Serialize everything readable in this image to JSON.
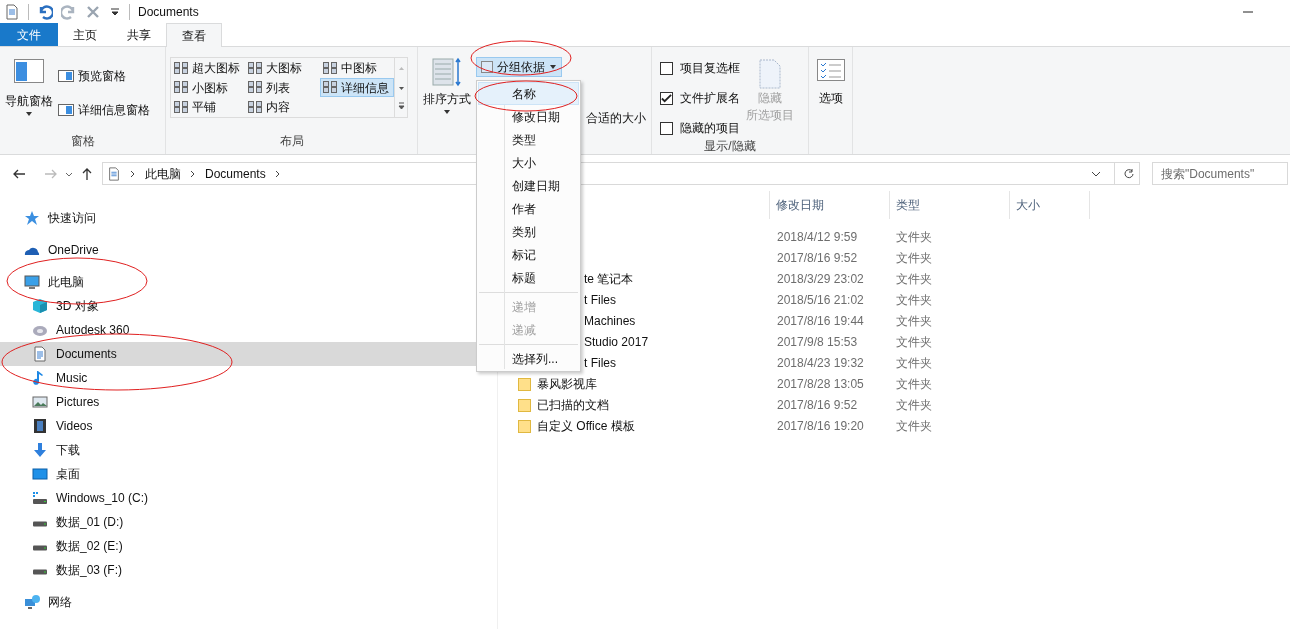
{
  "title_bar": {
    "title": "Documents"
  },
  "ribbon_tabs": [
    {
      "label": "文件",
      "kind": "file",
      "selected": false
    },
    {
      "label": "主页",
      "kind": "tab",
      "selected": false
    },
    {
      "label": "共享",
      "kind": "tab",
      "selected": false
    },
    {
      "label": "查看",
      "kind": "tab",
      "selected": true
    }
  ],
  "ribbon": {
    "panes": {
      "label": "窗格",
      "nav_pane": "导航窗格",
      "preview_pane": "预览窗格",
      "details_pane": "详细信息窗格"
    },
    "layout": {
      "label": "布局",
      "options": [
        {
          "label": "超大图标",
          "selected": false
        },
        {
          "label": "大图标",
          "selected": false
        },
        {
          "label": "中图标",
          "selected": false
        },
        {
          "label": "小图标",
          "selected": false
        },
        {
          "label": "列表",
          "selected": false
        },
        {
          "label": "详细信息",
          "selected": true
        },
        {
          "label": "平铺",
          "selected": false
        },
        {
          "label": "内容",
          "selected": false
        }
      ]
    },
    "current_view": {
      "sort_by": "排序方式",
      "group_by": "分组依据",
      "fit_columns": "合适的大小"
    },
    "show_hide": {
      "label": "显示/隐藏",
      "checkboxes": [
        {
          "label": "项目复选框",
          "checked": false
        },
        {
          "label": "文件扩展名",
          "checked": true
        },
        {
          "label": "隐藏的项目",
          "checked": false
        }
      ],
      "hide_selected": {
        "label_lines": [
          "隐藏",
          "所选项目"
        ],
        "disabled": true
      }
    },
    "options": "选项"
  },
  "address_bar": {
    "path": [
      "此电脑",
      "Documents"
    ]
  },
  "search": {
    "placeholder": "搜索\"Documents\""
  },
  "sidebar": {
    "items": [
      {
        "label": "快速访问",
        "selected": false
      },
      {
        "label": "OneDrive",
        "selected": false
      },
      {
        "label": "此电脑",
        "selected": false,
        "children": [
          {
            "label": "3D 对象",
            "selected": false
          },
          {
            "label": "Autodesk 360",
            "selected": false
          },
          {
            "label": "Documents",
            "selected": true
          },
          {
            "label": "Music",
            "selected": false
          },
          {
            "label": "Pictures",
            "selected": false
          },
          {
            "label": "Videos",
            "selected": false
          },
          {
            "label": "下载",
            "selected": false
          },
          {
            "label": "桌面",
            "selected": false
          },
          {
            "label": "Windows_10 (C:)",
            "selected": false
          },
          {
            "label": "数据_01 (D:)",
            "selected": false
          },
          {
            "label": "数据_02 (E:)",
            "selected": false
          },
          {
            "label": "数据_03 (F:)",
            "selected": false
          }
        ]
      },
      {
        "label": "网络",
        "selected": false
      }
    ]
  },
  "file_list": {
    "columns": [
      {
        "label": "修改日期"
      },
      {
        "label": "类型"
      },
      {
        "label": "大小"
      }
    ],
    "rows": [
      {
        "kind": "covered",
        "modified": "2018/4/12 9:59",
        "type": "文件夹"
      },
      {
        "kind": "covered",
        "modified": "2017/8/16 9:52",
        "type": "文件夹"
      },
      {
        "kind": "covered",
        "name": "te 笔记本",
        "modified": "2018/3/29 23:02",
        "type": "文件夹"
      },
      {
        "kind": "covered",
        "name": "t Files",
        "modified": "2018/5/16 21:02",
        "type": "文件夹"
      },
      {
        "kind": "covered",
        "name": "Machines",
        "modified": "2017/8/16 19:44",
        "type": "文件夹"
      },
      {
        "kind": "covered",
        "name": "Studio 2017",
        "modified": "2017/9/8 15:53",
        "type": "文件夹"
      },
      {
        "kind": "covered",
        "name": "t Files",
        "modified": "2018/4/23 19:32",
        "type": "文件夹"
      },
      {
        "kind": "folder",
        "name": "暴风影视库",
        "modified": "2017/8/28 13:05",
        "type": "文件夹"
      },
      {
        "kind": "folder",
        "name": "已扫描的文档",
        "modified": "2017/8/16 9:52",
        "type": "文件夹"
      },
      {
        "kind": "folder",
        "name": "自定义 Office 模板",
        "modified": "2017/8/16 19:20",
        "type": "文件夹"
      }
    ]
  },
  "group_by_menu": {
    "items": [
      {
        "kind": "item",
        "label": "名称",
        "selected": true,
        "disabled": false
      },
      {
        "kind": "item",
        "label": "修改日期",
        "selected": false,
        "disabled": false
      },
      {
        "kind": "item",
        "label": "类型",
        "selected": false,
        "disabled": false
      },
      {
        "kind": "item",
        "label": "大小",
        "selected": false,
        "disabled": false
      },
      {
        "kind": "item",
        "label": "创建日期",
        "selected": false,
        "disabled": false
      },
      {
        "kind": "item",
        "label": "作者",
        "selected": false,
        "disabled": false
      },
      {
        "kind": "item",
        "label": "类别",
        "selected": false,
        "disabled": false
      },
      {
        "kind": "item",
        "label": "标记",
        "selected": false,
        "disabled": false
      },
      {
        "kind": "item",
        "label": "标题",
        "selected": false,
        "disabled": false
      },
      {
        "kind": "separator"
      },
      {
        "kind": "item",
        "label": "递增",
        "selected": false,
        "disabled": true
      },
      {
        "kind": "item",
        "label": "递减",
        "selected": false,
        "disabled": true
      },
      {
        "kind": "separator"
      },
      {
        "kind": "item",
        "label": "选择列...",
        "selected": false,
        "disabled": false
      }
    ]
  }
}
